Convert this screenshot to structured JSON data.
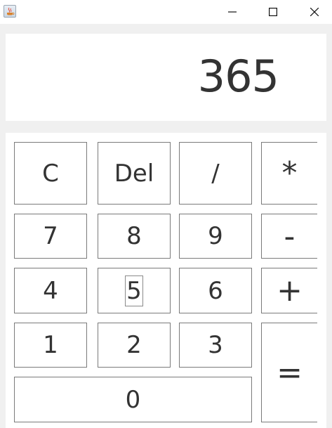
{
  "display": {
    "value": "365"
  },
  "keys": {
    "clear": "C",
    "delete": "Del",
    "divide": "/",
    "multiply": "*",
    "seven": "7",
    "eight": "8",
    "nine": "9",
    "minus": "-",
    "four": "4",
    "five": "5",
    "six": "6",
    "plus": "+",
    "one": "1",
    "two": "2",
    "three": "3",
    "equals": "=",
    "zero": "0"
  },
  "icons": {
    "app": "java-app-icon",
    "minimize": "minimize-icon",
    "maximize": "maximize-icon",
    "close": "close-icon"
  },
  "colors": {
    "key_text": "#333333",
    "key_border": "#7a7a7a",
    "background": "#f0f0f0"
  }
}
